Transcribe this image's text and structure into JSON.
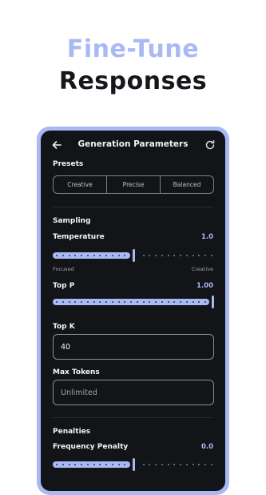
{
  "promo": {
    "line1": "Fine-Tune",
    "line2": "Responses"
  },
  "colors": {
    "accent": "#a9b9f4",
    "screen_bg": "#131418",
    "text_primary": "#f2f3f7",
    "text_muted": "#9ea2ae"
  },
  "appbar": {
    "title": "Generation Parameters",
    "back_icon": "arrow-left-icon",
    "refresh_icon": "refresh-icon"
  },
  "presets": {
    "title": "Presets",
    "options": [
      "Creative",
      "Precise",
      "Balanced"
    ]
  },
  "sampling": {
    "title": "Sampling",
    "temperature": {
      "label": "Temperature",
      "value": "1.0",
      "fraction": 0.5,
      "min_hint": "Focused",
      "max_hint": "Creative"
    },
    "top_p": {
      "label": "Top P",
      "value": "1.00",
      "fraction": 1.0
    },
    "top_k": {
      "label": "Top K",
      "value": "40"
    },
    "max_tokens": {
      "label": "Max Tokens",
      "placeholder": "Unlimited"
    }
  },
  "penalties": {
    "title": "Penalties",
    "frequency": {
      "label": "Frequency Penalty",
      "value": "0.0",
      "fraction": 0.5
    }
  }
}
